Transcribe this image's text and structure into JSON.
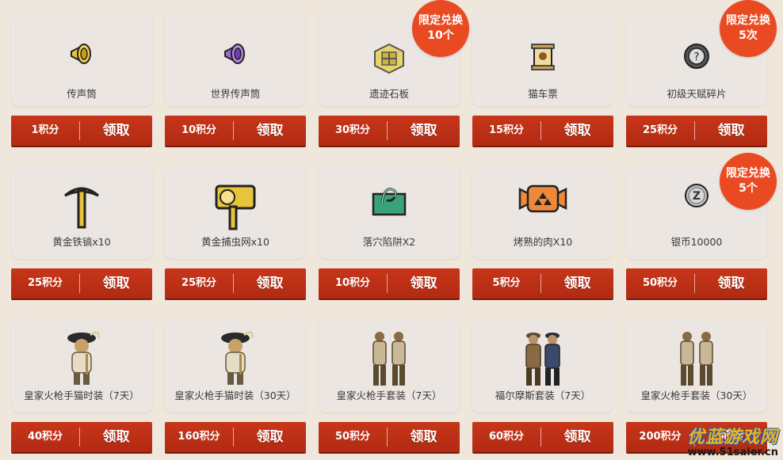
{
  "claim_label": "领取",
  "rows": [
    [
      {
        "name": "传声筒",
        "points": "1积分",
        "icon": "megaphone-icon",
        "badge": null
      },
      {
        "name": "世界传声筒",
        "points": "10积分",
        "icon": "world-megaphone-icon",
        "badge": null
      },
      {
        "name": "遗迹石板",
        "points": "30积分",
        "icon": "ruin-tablet-icon",
        "badge": [
          "限定兑换",
          "10个"
        ]
      },
      {
        "name": "猫车票",
        "points": "15积分",
        "icon": "cat-ticket-icon",
        "badge": null
      },
      {
        "name": "初级天赋碎片",
        "points": "25积分",
        "icon": "talent-shard-icon",
        "badge": [
          "限定兑换",
          "5次"
        ]
      }
    ],
    [
      {
        "name": "黄金铁镐x10",
        "points": "25积分",
        "icon": "golden-pickaxe-icon",
        "badge": null
      },
      {
        "name": "黄金捕虫网x10",
        "points": "25积分",
        "icon": "golden-bugnet-icon",
        "badge": null
      },
      {
        "name": "落穴陷阱X2",
        "points": "10积分",
        "icon": "pitfall-trap-icon",
        "badge": null
      },
      {
        "name": "烤熟的肉X10",
        "points": "5积分",
        "icon": "cooked-meat-icon",
        "badge": null
      },
      {
        "name": "银币10000",
        "points": "50积分",
        "icon": "silver-coin-icon",
        "badge": [
          "限定兑换",
          "5个"
        ]
      }
    ],
    [
      {
        "name": "皇家火枪手猫时装（7天）",
        "points": "40积分",
        "icon": "royal-musketeer-cat-icon",
        "badge": null
      },
      {
        "name": "皇家火枪手猫时装（30天）",
        "points": "160积分",
        "icon": "royal-musketeer-cat-icon",
        "badge": null
      },
      {
        "name": "皇家火枪手套装（7天）",
        "points": "50积分",
        "icon": "royal-musketeer-suit-icon",
        "badge": null
      },
      {
        "name": "福尔摩斯套装（7天）",
        "points": "60积分",
        "icon": "holmes-suit-icon",
        "badge": null
      },
      {
        "name": "皇家火枪手套装（30天）",
        "points": "200积分",
        "icon": "royal-musketeer-suit-icon",
        "badge": null
      }
    ]
  ],
  "watermark": {
    "logo": "优蓝游戏网",
    "url": "www.51saier.cn"
  },
  "colors": {
    "bar": "#b82e14",
    "badge": "#ea4a22",
    "card": "#ece6e2",
    "background": "#efe6dc"
  }
}
